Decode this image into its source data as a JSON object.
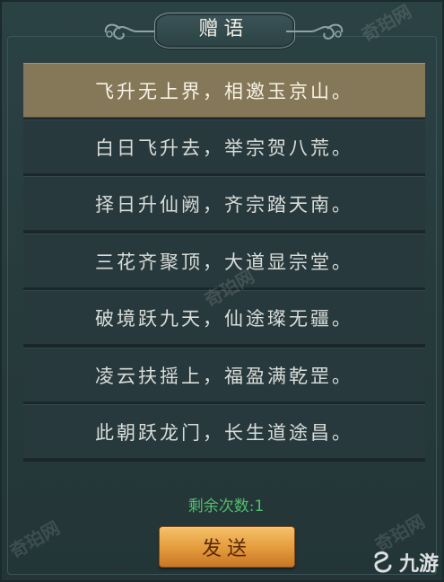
{
  "dialog": {
    "title": "赠语"
  },
  "messages": [
    {
      "text": "飞升无上界，相邀玉京山。",
      "selected": true
    },
    {
      "text": "白日飞升去，举宗贺八荒。",
      "selected": false
    },
    {
      "text": "择日升仙阙，齐宗踏天南。",
      "selected": false
    },
    {
      "text": "三花齐聚顶，大道显宗堂。",
      "selected": false
    },
    {
      "text": "破境跃九天，仙途璨无疆。",
      "selected": false
    },
    {
      "text": "凌云扶摇上，福盈满乾罡。",
      "selected": false
    },
    {
      "text": "此朝跃龙门，长生道途昌。",
      "selected": false
    }
  ],
  "footer": {
    "remaining_label": "剩余次数:",
    "remaining_count": "1",
    "send_label": "发送"
  },
  "watermarks": {
    "site": "奇珀网",
    "brand": "九游"
  },
  "colors": {
    "panel": "#26393b",
    "row": "#28393d",
    "row_selected": "#857858",
    "remaining_text": "#4fc06a",
    "button": "#e39a3b"
  }
}
